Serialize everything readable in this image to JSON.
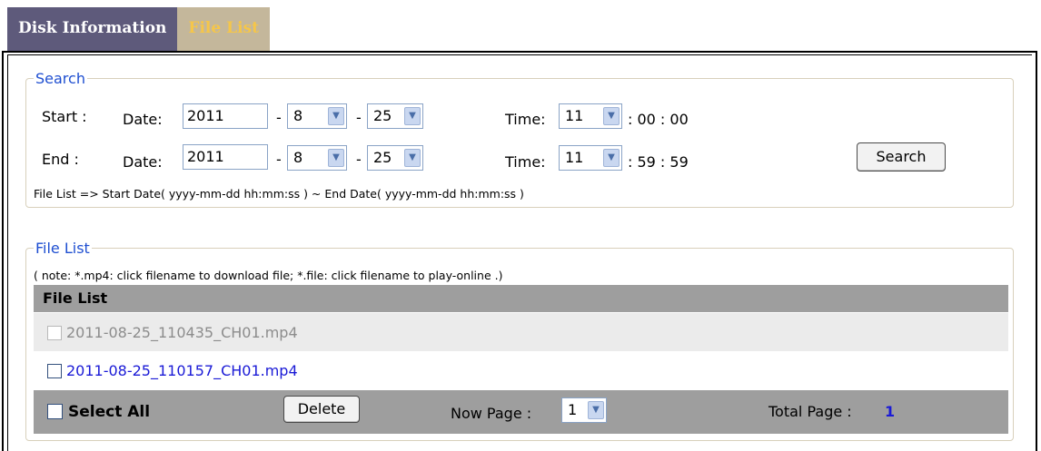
{
  "tabs": {
    "disk_info": "Disk Information",
    "file_list": "File List"
  },
  "search": {
    "legend": "Search",
    "start_label": "Start :",
    "end_label": "End :",
    "date_label": "Date:",
    "time_label": "Time:",
    "dash": "-",
    "start": {
      "year": "2011",
      "month": "8",
      "day": "25",
      "hour": "11",
      "min_sec": ": 00 : 00"
    },
    "end": {
      "year": "2011",
      "month": "8",
      "day": "25",
      "hour": "11",
      "min_sec": ": 59 : 59"
    },
    "button": "Search",
    "format_note": "File List => Start Date( yyyy-mm-dd hh:mm:ss ) ~ End Date( yyyy-mm-dd hh:mm:ss )"
  },
  "filelist": {
    "legend": "File List",
    "note": "( note: *.mp4: click filename to download file; *.file: click filename to play-online .)",
    "header": "File List",
    "files": [
      {
        "name": "2011-08-25_110435_CH01.mp4",
        "color": "#8c8c8c"
      },
      {
        "name": "2011-08-25_110157_CH01.mp4",
        "color": "#1a1ad6"
      }
    ],
    "select_all": "Select All",
    "delete": "Delete",
    "now_page_label": "Now Page :",
    "now_page_value": "1",
    "total_page_label": "Total Page :",
    "total_page_value": "1"
  },
  "colors": {
    "legend": "#1f4fd1",
    "header_bar": "#9e9e9e",
    "row_alt": "#ebebeb",
    "link": "#1a1ad6"
  }
}
